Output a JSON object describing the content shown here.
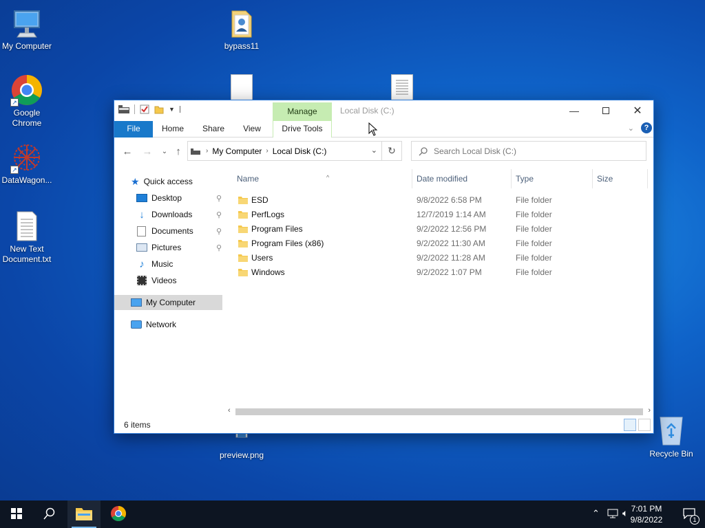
{
  "desktop": {
    "icons": [
      {
        "label": "My Computer",
        "icon": "monitor-icon"
      },
      {
        "label": "bypass11",
        "icon": "folder-icon"
      },
      {
        "label": "Google Chrome",
        "icon": "chrome-icon"
      },
      {
        "label": "DataWagon...",
        "icon": "datawagon-icon"
      },
      {
        "label": "New Text Document.txt",
        "icon": "text-file-icon"
      },
      {
        "label": "preview.png",
        "icon": "image-file-icon"
      },
      {
        "label": "Recycle Bin",
        "icon": "recycle-bin-icon"
      }
    ]
  },
  "window": {
    "title": "Local Disk (C:)",
    "context_tab_group": "Manage",
    "ribbon_tabs": [
      "File",
      "Home",
      "Share",
      "View",
      "Drive Tools"
    ],
    "help_label": "?",
    "address": {
      "segments": [
        "My Computer",
        "Local Disk (C:)"
      ]
    },
    "search_placeholder": "Search Local Disk (C:)",
    "nav": {
      "quick_access": "Quick access",
      "items": [
        {
          "label": "Desktop",
          "icon": "desktop-icon",
          "pinned": true
        },
        {
          "label": "Downloads",
          "icon": "downloads-icon",
          "pinned": true
        },
        {
          "label": "Documents",
          "icon": "documents-icon",
          "pinned": true
        },
        {
          "label": "Pictures",
          "icon": "pictures-icon",
          "pinned": true
        },
        {
          "label": "Music",
          "icon": "music-icon",
          "pinned": false
        },
        {
          "label": "Videos",
          "icon": "videos-icon",
          "pinned": false
        }
      ],
      "my_computer": "My Computer",
      "network": "Network"
    },
    "columns": [
      "Name",
      "Date modified",
      "Type",
      "Size"
    ],
    "files": [
      {
        "name": "ESD",
        "date": "9/8/2022 6:58 PM",
        "type": "File folder"
      },
      {
        "name": "PerfLogs",
        "date": "12/7/2019 1:14 AM",
        "type": "File folder"
      },
      {
        "name": "Program Files",
        "date": "9/2/2022 12:56 PM",
        "type": "File folder"
      },
      {
        "name": "Program Files (x86)",
        "date": "9/2/2022 11:30 AM",
        "type": "File folder"
      },
      {
        "name": "Users",
        "date": "9/2/2022 11:28 AM",
        "type": "File folder"
      },
      {
        "name": "Windows",
        "date": "9/2/2022 1:07 PM",
        "type": "File folder"
      }
    ],
    "status": "6 items"
  },
  "taskbar": {
    "time": "7:01 PM",
    "date": "9/8/2022",
    "notification_count": "1"
  },
  "colors": {
    "accent": "#1979ca",
    "manage_tab": "#c6ecb2",
    "folder": "#f5c84c",
    "taskbar": "#0d1522"
  }
}
